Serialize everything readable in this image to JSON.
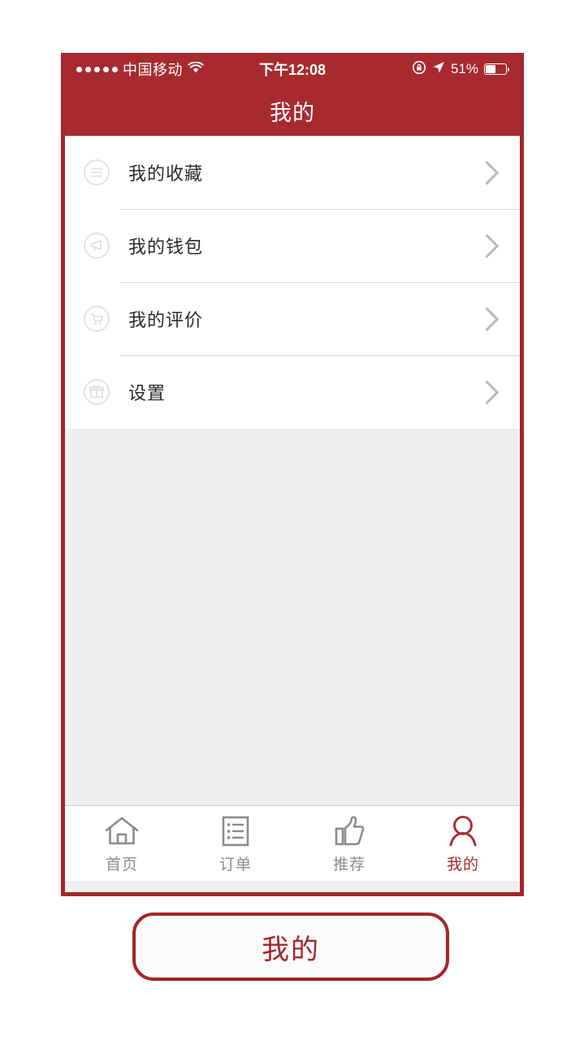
{
  "status_bar": {
    "signal_dots": 5,
    "carrier": "中国移动",
    "wifi_icon": "wifi-icon",
    "time": "下午12:08",
    "rotation_lock_icon": "rotation-lock-icon",
    "location_icon": "location-arrow-icon",
    "battery_percent": "51%",
    "battery_level": 51
  },
  "nav": {
    "title": "我的"
  },
  "list": {
    "items": [
      {
        "label": "我的收藏",
        "icon": "list-lines-circle-icon",
        "chevron": "chevron-right-icon"
      },
      {
        "label": "我的钱包",
        "icon": "megaphone-circle-icon",
        "chevron": "chevron-right-icon"
      },
      {
        "label": "我的评价",
        "icon": "shopping-cart-circle-icon",
        "chevron": "chevron-right-icon"
      },
      {
        "label": "设置",
        "icon": "gift-circle-icon",
        "chevron": "chevron-right-icon"
      }
    ]
  },
  "tab_bar": {
    "tabs": [
      {
        "label": "首页",
        "icon": "home-icon",
        "active": false
      },
      {
        "label": "订单",
        "icon": "order-list-icon",
        "active": false
      },
      {
        "label": "推荐",
        "icon": "thumbs-up-icon",
        "active": false
      },
      {
        "label": "我的",
        "icon": "person-icon",
        "active": true
      }
    ]
  },
  "callout": {
    "text": "我的"
  },
  "colors": {
    "brand_red": "#a72a2f",
    "frame_red": "#a3262a",
    "page_bg": "#efefef",
    "row_bg": "#ffffff",
    "label_text": "#2b2b2b",
    "tab_inactive": "#8c8c8c"
  }
}
